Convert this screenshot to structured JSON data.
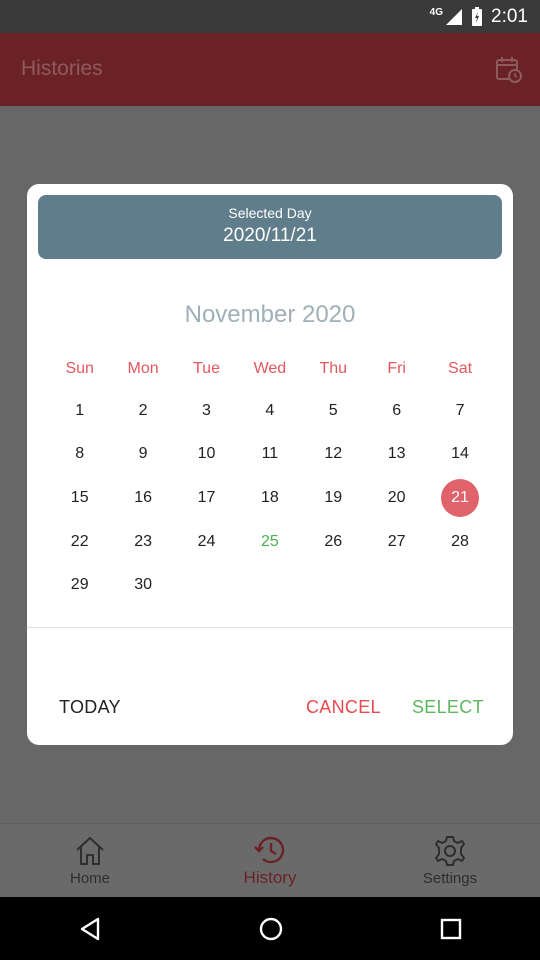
{
  "status_bar": {
    "network": "4G",
    "time": "2:01"
  },
  "app_bar": {
    "title": "Histories",
    "action_icon": "calendar-clock-icon"
  },
  "dialog": {
    "header_label": "Selected Day",
    "selected_date": "2020/11/21",
    "month_title": "November 2020",
    "weekdays": [
      "Sun",
      "Mon",
      "Tue",
      "Wed",
      "Thu",
      "Fri",
      "Sat"
    ],
    "weeks": [
      [
        "1",
        "2",
        "3",
        "4",
        "5",
        "6",
        "7"
      ],
      [
        "8",
        "9",
        "10",
        "11",
        "12",
        "13",
        "14"
      ],
      [
        "15",
        "16",
        "17",
        "18",
        "19",
        "20",
        "21"
      ],
      [
        "22",
        "23",
        "24",
        "25",
        "26",
        "27",
        "28"
      ],
      [
        "29",
        "30",
        "",
        "",
        "",
        "",
        ""
      ]
    ],
    "selected_day": "21",
    "today_day": "25",
    "buttons": {
      "today": "TODAY",
      "cancel": "CANCEL",
      "select": "SELECT"
    },
    "colors": {
      "header": "#607d8b",
      "weekday": "#e2585e",
      "selected": "#e0626a",
      "today": "#4caf50",
      "cancel": "#e84a4f",
      "select": "#5cb85c"
    }
  },
  "bottom_nav": [
    {
      "label": "Home",
      "icon": "home-icon"
    },
    {
      "label": "History",
      "icon": "history-icon"
    },
    {
      "label": "Settings",
      "icon": "gear-icon"
    }
  ]
}
